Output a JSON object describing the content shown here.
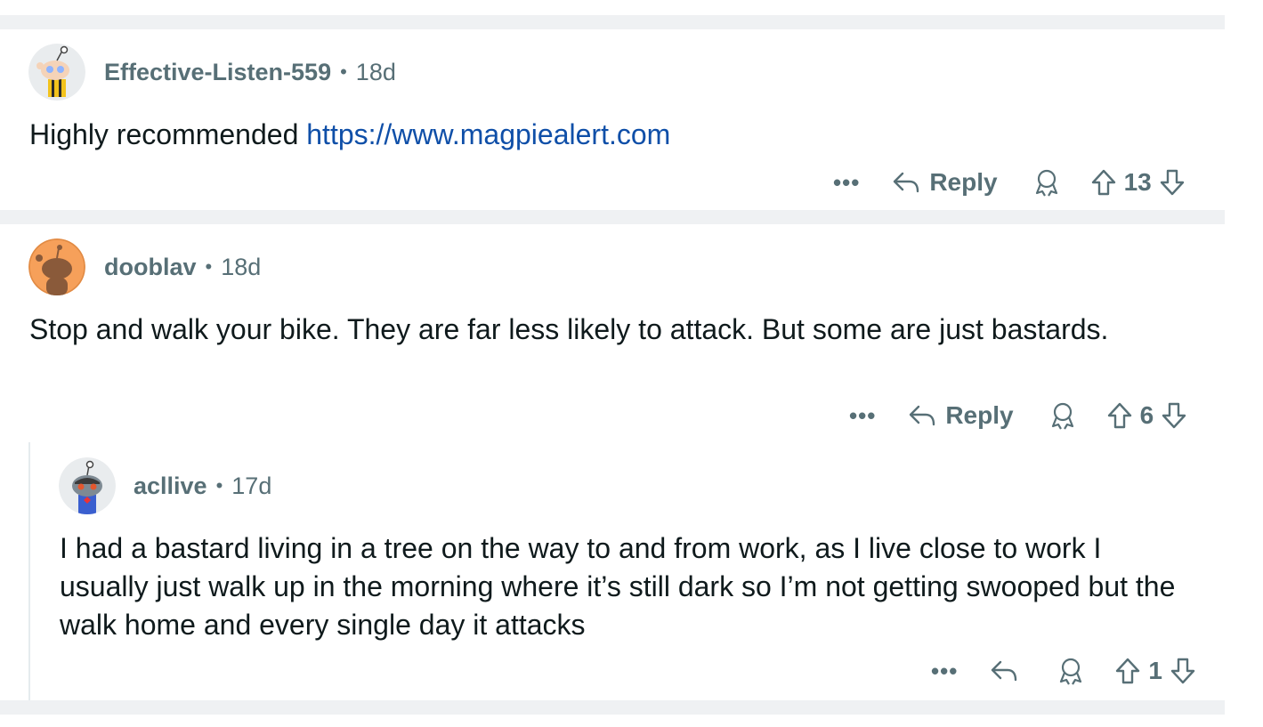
{
  "comments": [
    {
      "user": "Effective-Listen-559",
      "separator": "•",
      "age": "18d",
      "text": "Highly recommended ",
      "link": "https://www.magpiealert.com",
      "more": "•••",
      "reply_label": "Reply",
      "votes": "13",
      "avatar": "reddit-snoo-avatar-bee-shirt-icon"
    },
    {
      "user": "dooblav",
      "separator": "•",
      "age": "18d",
      "text": "Stop and walk your bike. They are far less likely to attack. But some are just bastards.",
      "more": "•••",
      "reply_label": "Reply",
      "votes": "6",
      "avatar": "reddit-default-orange-avatar-icon"
    },
    {
      "user": "acllive",
      "separator": "•",
      "age": "17d",
      "text": "I had a bastard living in a tree on the way to and from work, as I live close to work I usually just walk up in the morning where it’s still dark so I’m not getting swooped but the walk home and every single day it attacks",
      "more": "•••",
      "votes": "1",
      "avatar": "reddit-snoo-avatar-robot-icon"
    }
  ],
  "colors": {
    "background": "#eff1f3",
    "card": "#ffffff",
    "muted": "#576f76",
    "link": "#0f4fa8"
  }
}
